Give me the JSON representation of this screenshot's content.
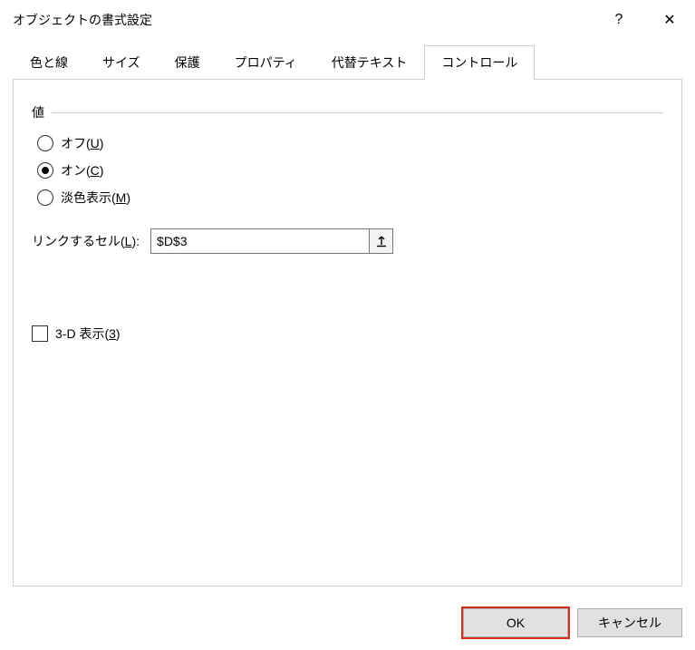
{
  "titlebar": {
    "title": "オブジェクトの書式設定",
    "help": "?",
    "close": "✕"
  },
  "tabs": [
    {
      "label": "色と線",
      "active": false
    },
    {
      "label": "サイズ",
      "active": false
    },
    {
      "label": "保護",
      "active": false
    },
    {
      "label": "プロパティ",
      "active": false
    },
    {
      "label": "代替テキスト",
      "active": false
    },
    {
      "label": "コントロール",
      "active": true
    }
  ],
  "group": {
    "title": "値",
    "options": {
      "off_pre": "オフ(",
      "off_u": "U",
      "off_post": ")",
      "on_pre": "オン(",
      "on_u": "C",
      "on_post": ")",
      "mixed_pre": "淡色表示(",
      "mixed_u": "M",
      "mixed_post": ")"
    },
    "selected": "on"
  },
  "link": {
    "label_pre": "リンクするセル(",
    "label_u": "L",
    "label_post": "):",
    "value": "$D$3"
  },
  "threed": {
    "label_pre": "3-D 表示(",
    "label_u": "3",
    "label_post": ")",
    "checked": false
  },
  "footer": {
    "ok": "OK",
    "cancel": "キャンセル"
  }
}
